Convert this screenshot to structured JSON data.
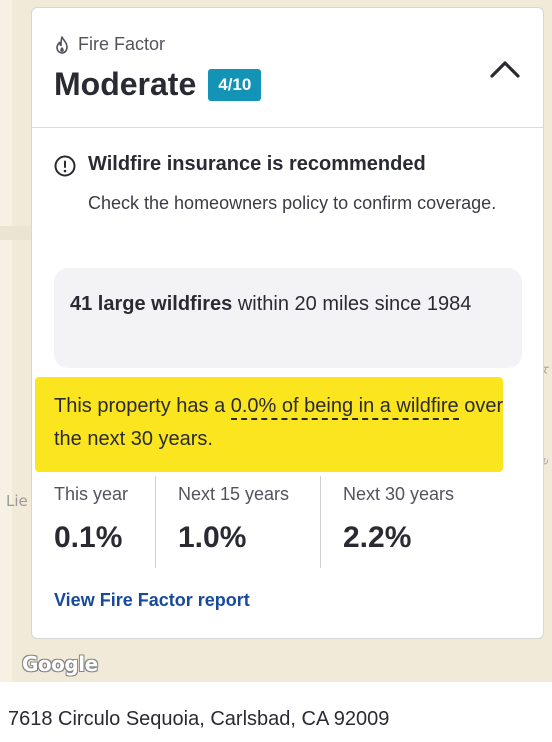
{
  "card": {
    "factor_name": "Fire Factor",
    "risk_level": "Moderate",
    "score_badge": "4/10",
    "insurance_title": "Wildfire insurance is recommended",
    "insurance_desc": "Check the homeowners policy to confirm coverage.",
    "stats_bold": "41 large wildfires",
    "stats_rest": " within 20 miles since 1984",
    "probability_prefix": "This property has a ",
    "probability_underlined": "0.0% of being in a wildfire",
    "probability_suffix": " over the next 30 years.",
    "periods": [
      {
        "label": "This year",
        "value": "0.1%"
      },
      {
        "label": "Next 15 years",
        "value": "1.0%"
      },
      {
        "label": "Next 30 years",
        "value": "2.2%"
      }
    ],
    "report_link": "View Fire Factor report"
  },
  "map": {
    "label_left": "Lie",
    "label_right1": "A",
    "label_right2": "e",
    "google_logo": "Google"
  },
  "address": "7618 Circulo Sequoia, Carlsbad, CA 92009",
  "colors": {
    "badge": "#1393b5",
    "highlight": "#fbe51f",
    "link": "#174a9b",
    "map": "#f2ead8"
  }
}
